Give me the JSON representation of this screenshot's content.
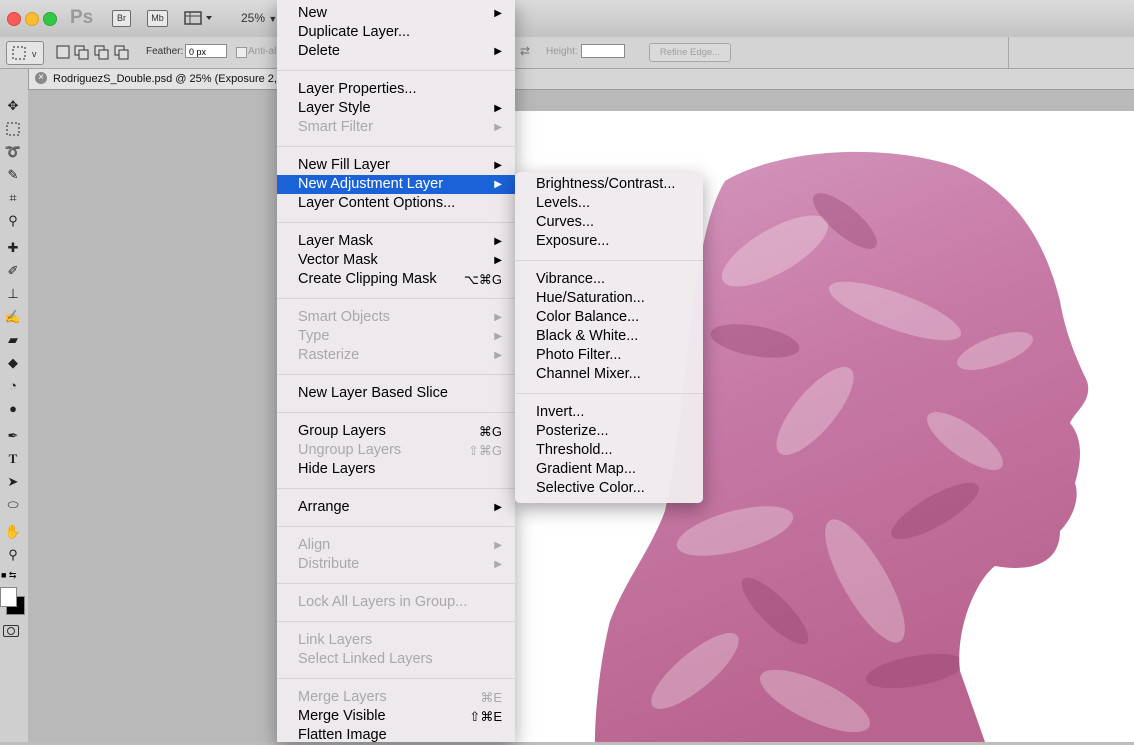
{
  "app_bar": {
    "logo": "Ps",
    "bridge": "Br",
    "minibridge": "Mb",
    "zoom": "25%"
  },
  "options_bar": {
    "feather_label": "Feather:",
    "feather_value": "0 px",
    "antialias_label": "Anti-al",
    "height_label": "Height:",
    "refine_edge": "Refine Edge..."
  },
  "document_tab": {
    "title": "RodriguezS_Double.psd @ 25% (Exposure 2,"
  },
  "layer_menu": {
    "items": [
      {
        "label": "New",
        "submenu": true
      },
      {
        "label": "Duplicate Layer..."
      },
      {
        "label": "Delete",
        "submenu": true
      },
      {
        "label": "Layer Properties..."
      },
      {
        "label": "Layer Style",
        "submenu": true
      },
      {
        "label": "Smart Filter",
        "submenu": true,
        "disabled": true
      },
      {
        "label": "New Fill Layer",
        "submenu": true
      },
      {
        "label": "New Adjustment Layer",
        "submenu": true,
        "highlighted": true
      },
      {
        "label": "Layer Content Options..."
      },
      {
        "label": "Layer Mask",
        "submenu": true
      },
      {
        "label": "Vector Mask",
        "submenu": true
      },
      {
        "label": "Create Clipping Mask",
        "shortcut": "⌥⌘G"
      },
      {
        "label": "Smart Objects",
        "submenu": true,
        "disabled": true
      },
      {
        "label": "Type",
        "submenu": true,
        "disabled": true
      },
      {
        "label": "Rasterize",
        "submenu": true,
        "disabled": true
      },
      {
        "label": "New Layer Based Slice"
      },
      {
        "label": "Group Layers",
        "shortcut": "⌘G"
      },
      {
        "label": "Ungroup Layers",
        "shortcut": "⇧⌘G",
        "disabled": true
      },
      {
        "label": "Hide Layers"
      },
      {
        "label": "Arrange",
        "submenu": true
      },
      {
        "label": "Align",
        "submenu": true,
        "disabled": true
      },
      {
        "label": "Distribute",
        "submenu": true,
        "disabled": true
      },
      {
        "label": "Lock All Layers in Group...",
        "disabled": true
      },
      {
        "label": "Link Layers",
        "disabled": true
      },
      {
        "label": "Select Linked Layers",
        "disabled": true
      },
      {
        "label": "Merge Layers",
        "shortcut": "⌘E",
        "disabled": true
      },
      {
        "label": "Merge Visible",
        "shortcut": "⇧⌘E"
      },
      {
        "label": "Flatten Image"
      }
    ]
  },
  "adjustment_submenu": {
    "items": [
      {
        "label": "Brightness/Contrast..."
      },
      {
        "label": "Levels..."
      },
      {
        "label": "Curves..."
      },
      {
        "label": "Exposure..."
      },
      {
        "label": "Vibrance..."
      },
      {
        "label": "Hue/Saturation..."
      },
      {
        "label": "Color Balance..."
      },
      {
        "label": "Black & White..."
      },
      {
        "label": "Photo Filter..."
      },
      {
        "label": "Channel Mixer..."
      },
      {
        "label": "Invert..."
      },
      {
        "label": "Posterize..."
      },
      {
        "label": "Threshold..."
      },
      {
        "label": "Gradient Map..."
      },
      {
        "label": "Selective Color..."
      }
    ]
  },
  "colors": {
    "highlight": "#1b61d8",
    "disabled_text": "#a9a9a9",
    "artwork_pink": "#c77aa6"
  }
}
